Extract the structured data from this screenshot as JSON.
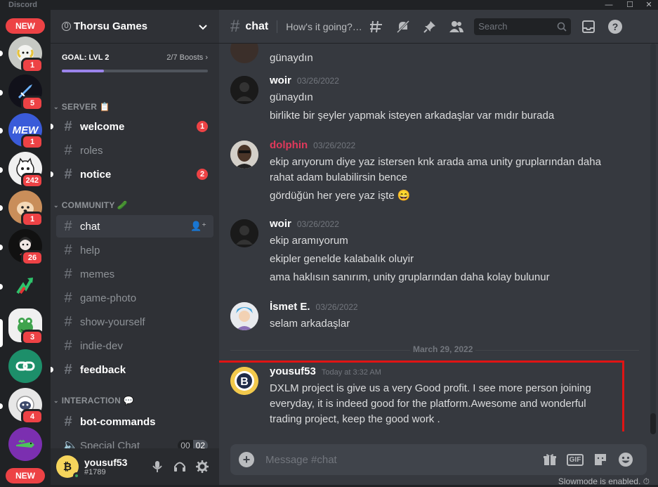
{
  "app": {
    "title": "Discord",
    "window_controls": [
      "—",
      "☐",
      "✕"
    ]
  },
  "guilds": [
    {
      "label": "NEW",
      "type": "new"
    },
    {
      "icon": "ram-icon",
      "badge": "1",
      "color": "#b9bbbe"
    },
    {
      "icon": "sword-icon",
      "badge": "5",
      "color": "#11111a"
    },
    {
      "label": "MEW",
      "icon": "mew-icon",
      "badge": "1",
      "color": "#3a5bd9"
    },
    {
      "icon": "cat-icon",
      "badge": "242",
      "color": "#f0f0f0"
    },
    {
      "icon": "dog-icon",
      "badge": "1",
      "color": "#c98e5a"
    },
    {
      "icon": "girl-icon",
      "badge": "26",
      "color": "#111111"
    },
    {
      "icon": "arrow-icon",
      "badge": "",
      "color": "#202225"
    },
    {
      "icon": "frog-icon",
      "badge": "3",
      "color": "#f0f0f0"
    },
    {
      "icon": "link-icon",
      "badge": "",
      "color": "#1d8f6a"
    },
    {
      "icon": "astronaut-icon",
      "badge": "4",
      "color": "#e7e7e7"
    },
    {
      "icon": "crocodile-icon",
      "badge": "",
      "color": "#7b2fb0"
    },
    {
      "label": "NEW",
      "type": "new"
    }
  ],
  "server": {
    "name": "Thorsu Games",
    "partner_badge": "0",
    "goal_label": "GOAL: LVL 2",
    "boosts": "2/7 Boosts",
    "boost_progress": 0.29
  },
  "categories": {
    "server": "SERVER 📋",
    "community": "COMMUNITY 🥒",
    "interaction": "INTERACTION 💬"
  },
  "channels": [
    {
      "name": "welcome",
      "unread": true,
      "badge": "1"
    },
    {
      "name": "roles",
      "unread": false,
      "badge": ""
    },
    {
      "name": "notice",
      "unread": true,
      "badge": "2"
    },
    {
      "name": "chat",
      "active": true,
      "badge": ""
    },
    {
      "name": "help",
      "badge": ""
    },
    {
      "name": "memes",
      "badge": ""
    },
    {
      "name": "game-photo",
      "badge": ""
    },
    {
      "name": "show-yourself",
      "badge": ""
    },
    {
      "name": "indie-dev",
      "badge": ""
    },
    {
      "name": "feedback",
      "unread": true,
      "badge": ""
    },
    {
      "name": "bot-commands",
      "unread": true,
      "badge": ""
    },
    {
      "name": "Special Chat",
      "voice": true,
      "count_current": "00",
      "count_limit": "02"
    }
  ],
  "user": {
    "name": "yousuf53",
    "tag": "#1789"
  },
  "header": {
    "channel": "chat",
    "topic": "How's it going? ...",
    "search_placeholder": "Search"
  },
  "messages": [
    {
      "author": "",
      "time": "",
      "lines": [
        "günaydın"
      ],
      "partial": true
    },
    {
      "author": "woir",
      "time": "03/26/2022",
      "author_color": "#ffffff",
      "lines": [
        "günaydın",
        "birlikte bir şeyler yapmak isteyen arkadaşlar var mıdır burada"
      ]
    },
    {
      "author": "dolphin",
      "time": "03/26/2022",
      "author_color": "#e0395b",
      "lines": [
        "ekip arıyorum diye yaz istersen knk arada ama unity gruplarından daha rahat adam bulabilirsin bence",
        "gördüğün her yere yaz işte 😄"
      ]
    },
    {
      "author": "woir",
      "time": "03/26/2022",
      "author_color": "#ffffff",
      "lines": [
        "ekip aramıyorum",
        "ekipler genelde kalabalık oluyir",
        "ama haklısın sanırım, unity gruplarından daha kolay bulunur"
      ]
    },
    {
      "author": "İsmet E.",
      "time": "03/26/2022",
      "author_color": "#ffffff",
      "lines": [
        "selam arkadaşlar"
      ]
    },
    {
      "author": "yousuf53",
      "time": "Today at 3:32 AM",
      "author_color": "#ffffff",
      "lines": [
        "DXLM  project is give us a very Good profit. I see more person joining everyday, it is indeed good for the platform.Awesome and wonderful trading project, keep the good work ."
      ]
    }
  ],
  "date_divider": "March 29, 2022",
  "composer": {
    "placeholder": "Message #chat",
    "gif_label": "GIF"
  },
  "slowmode": "Slowmode is enabled."
}
